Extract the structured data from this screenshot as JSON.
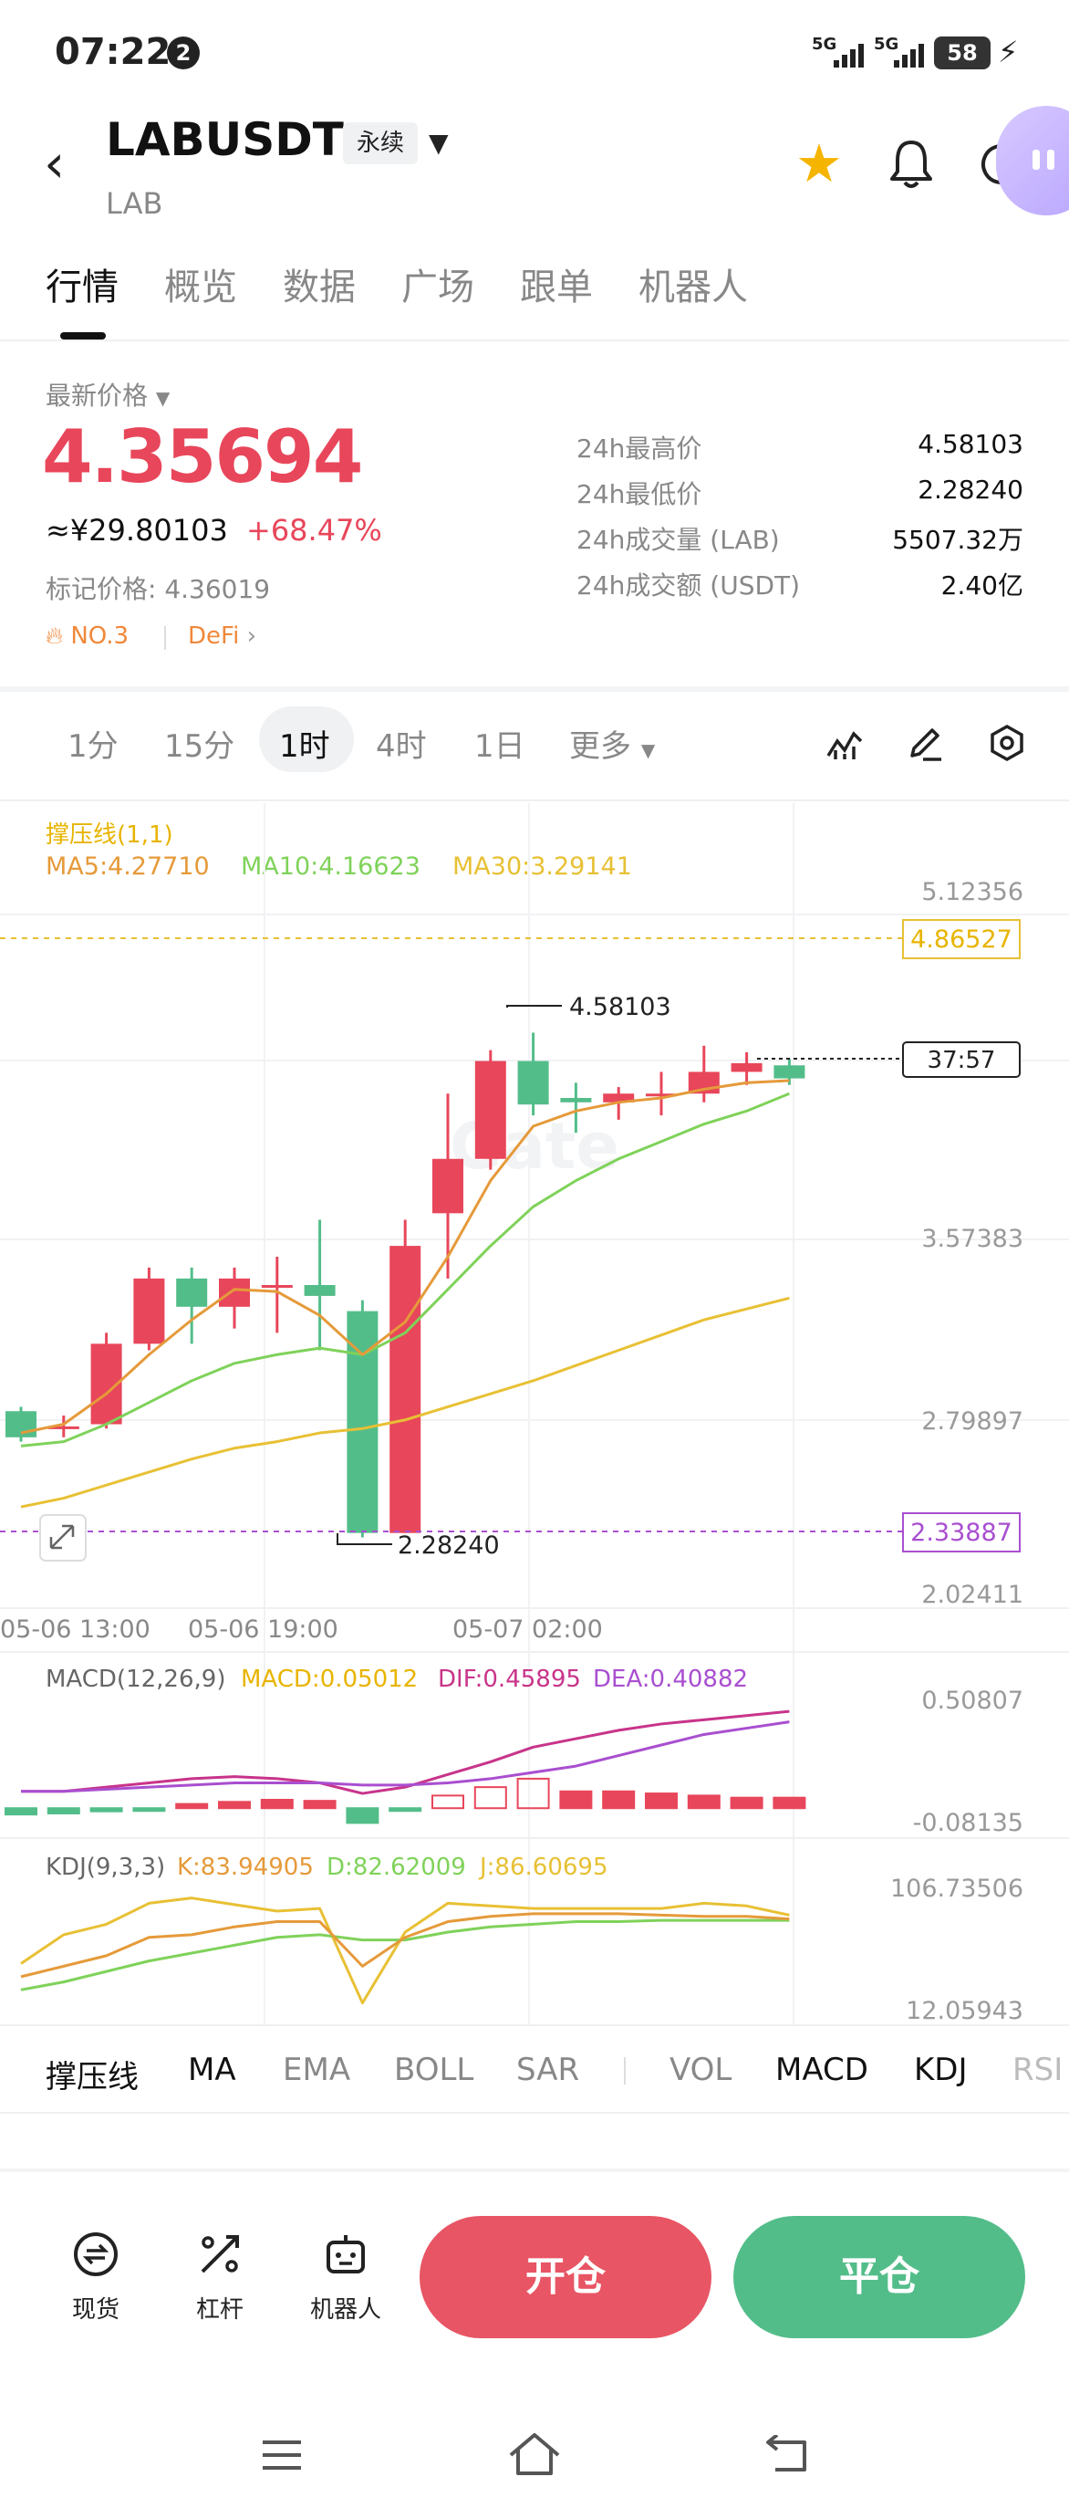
{
  "status_bar": {
    "time": "07:22",
    "notif_count": "2",
    "net1": "5G",
    "net2": "5G",
    "battery": "58"
  },
  "header": {
    "symbol": "LABUSDT",
    "contract_type": "永续",
    "base": "LAB"
  },
  "tabs": [
    {
      "label": "行情"
    },
    {
      "label": "概览"
    },
    {
      "label": "数据"
    },
    {
      "label": "广场"
    },
    {
      "label": "跟单"
    },
    {
      "label": "机器人"
    }
  ],
  "ticker": {
    "latest_label": "最新价格",
    "price": "4.35694",
    "cny": "≈¥29.80103",
    "change": "+68.47%",
    "mark_price": "标记价格: 4.36019",
    "rank": "NO.3",
    "tag": "DeFi",
    "stats": [
      {
        "label": "24h最高价",
        "value": "4.58103"
      },
      {
        "label": "24h最低价",
        "value": "2.28240"
      },
      {
        "label": "24h成交量 (LAB)",
        "value": "5507.32万"
      },
      {
        "label": "24h成交额 (USDT)",
        "value": "2.40亿"
      }
    ]
  },
  "intervals": [
    {
      "label": "1分"
    },
    {
      "label": "15分"
    },
    {
      "label": "1时"
    },
    {
      "label": "4时"
    },
    {
      "label": "1日"
    },
    {
      "label": "更多"
    }
  ],
  "chart_legend": {
    "sr": "撑压线(1,1)",
    "ma5": "MA5:4.27710",
    "ma10": "MA10:4.16623",
    "ma30": "MA30:3.29141"
  },
  "chart_labels": {
    "y_ticks": [
      "5.12356",
      "3.57383",
      "2.79897",
      "2.02411"
    ],
    "resistance": "4.86527",
    "support": "2.33887",
    "countdown": "37:57",
    "high": "4.58103",
    "low": "2.28240",
    "x_ticks": [
      "05-06 13:00",
      "05-06 19:00",
      "05-07 02:00"
    ],
    "macd_legend": {
      "name": "MACD(12,26,9)",
      "macd": "MACD:0.05012",
      "dif": "DIF:0.45895",
      "dea": "DEA:0.40882"
    },
    "macd_ticks": [
      "0.50807",
      "-0.08135"
    ],
    "kdj_legend": {
      "name": "KDJ(9,3,3)",
      "k": "K:83.94905",
      "d": "D:82.62009",
      "j": "J:86.60695"
    },
    "kdj_ticks": [
      "106.73506",
      "12.05943"
    ]
  },
  "chart_data": {
    "type": "candlestick",
    "ylim": [
      2.02411,
      5.12356
    ],
    "candles": [
      {
        "o": 2.84,
        "h": 2.86,
        "c": 2.72,
        "l": 2.7
      },
      {
        "o": 2.76,
        "h": 2.82,
        "c": 2.77,
        "l": 2.72
      },
      {
        "o": 2.78,
        "h": 3.2,
        "c": 3.15,
        "l": 2.76
      },
      {
        "o": 3.15,
        "h": 3.5,
        "c": 3.45,
        "l": 3.12
      },
      {
        "o": 3.45,
        "h": 3.5,
        "c": 3.32,
        "l": 3.15
      },
      {
        "o": 3.32,
        "h": 3.5,
        "c": 3.45,
        "l": 3.22
      },
      {
        "o": 3.42,
        "h": 3.55,
        "c": 3.42,
        "l": 3.2
      },
      {
        "o": 3.42,
        "h": 3.72,
        "c": 3.37,
        "l": 3.12
      },
      {
        "o": 3.3,
        "h": 3.35,
        "c": 2.28,
        "l": 2.26
      },
      {
        "o": 2.28,
        "h": 3.72,
        "c": 3.6,
        "l": 2.28
      },
      {
        "o": 3.75,
        "h": 4.3,
        "c": 4.0,
        "l": 3.45
      },
      {
        "o": 4.0,
        "h": 4.5,
        "c": 4.45,
        "l": 3.95
      },
      {
        "o": 4.45,
        "h": 4.58,
        "c": 4.25,
        "l": 4.2
      },
      {
        "o": 4.28,
        "h": 4.35,
        "c": 4.26,
        "l": 4.12
      },
      {
        "o": 4.26,
        "h": 4.33,
        "c": 4.3,
        "l": 4.18
      },
      {
        "o": 4.3,
        "h": 4.4,
        "c": 4.3,
        "l": 4.2
      },
      {
        "o": 4.3,
        "h": 4.52,
        "c": 4.4,
        "l": 4.26
      },
      {
        "o": 4.4,
        "h": 4.49,
        "c": 4.44,
        "l": 4.34
      },
      {
        "o": 4.43,
        "h": 4.46,
        "c": 4.37,
        "l": 4.34
      }
    ],
    "ma5": [
      2.74,
      2.78,
      2.92,
      3.1,
      3.26,
      3.4,
      3.39,
      3.28,
      3.1,
      3.25,
      3.55,
      3.9,
      4.15,
      4.22,
      4.26,
      4.28,
      4.32,
      4.35,
      4.36
    ],
    "ma10": [
      2.68,
      2.7,
      2.78,
      2.88,
      2.98,
      3.06,
      3.1,
      3.13,
      3.1,
      3.2,
      3.4,
      3.6,
      3.78,
      3.9,
      4.0,
      4.08,
      4.16,
      4.22,
      4.3
    ],
    "ma30": [
      2.4,
      2.44,
      2.5,
      2.56,
      2.62,
      2.67,
      2.7,
      2.74,
      2.76,
      2.8,
      2.86,
      2.92,
      2.98,
      3.05,
      3.12,
      3.19,
      3.26,
      3.31,
      3.36
    ],
    "macd_hist": [
      -0.03,
      -0.025,
      -0.015,
      -0.005,
      0.02,
      0.03,
      0.04,
      0.035,
      -0.07,
      -0.01,
      0.06,
      0.1,
      0.14,
      0.08,
      0.08,
      0.07,
      0.06,
      0.05,
      0.05
    ],
    "dif": [
      0.08,
      0.08,
      0.1,
      0.12,
      0.14,
      0.15,
      0.14,
      0.12,
      0.07,
      0.1,
      0.16,
      0.22,
      0.29,
      0.33,
      0.37,
      0.4,
      0.42,
      0.44,
      0.46
    ],
    "dea": [
      0.08,
      0.08,
      0.09,
      0.1,
      0.11,
      0.12,
      0.12,
      0.12,
      0.11,
      0.11,
      0.12,
      0.14,
      0.17,
      0.2,
      0.25,
      0.3,
      0.35,
      0.38,
      0.41
    ],
    "kdj_k": [
      40,
      48,
      56,
      70,
      72,
      78,
      82,
      82,
      48,
      70,
      82,
      86,
      88,
      88,
      88,
      87,
      86,
      86,
      84
    ],
    "kdj_d": [
      30,
      36,
      44,
      52,
      58,
      64,
      70,
      72,
      68,
      68,
      74,
      78,
      80,
      82,
      82,
      83,
      83,
      83,
      83
    ],
    "kdj_j": [
      50,
      72,
      80,
      96,
      100,
      95,
      90,
      92,
      20,
      74,
      96,
      94,
      92,
      92,
      92,
      92,
      96,
      94,
      87
    ]
  },
  "indicator_tabs": [
    {
      "label": "撑压线"
    },
    {
      "label": "MA"
    },
    {
      "label": "EMA"
    },
    {
      "label": "BOLL"
    },
    {
      "label": "SAR"
    },
    {
      "label": "VOL"
    },
    {
      "label": "MACD"
    },
    {
      "label": "KDJ"
    },
    {
      "label": "RSI"
    }
  ],
  "bottom_nav": {
    "spot": "现货",
    "lever": "杠杆",
    "robot": "机器人",
    "open": "开仓",
    "close": "平仓"
  },
  "colors": {
    "up": "#e8465a",
    "down": "#53bd8a",
    "ma5": "#e59a3a",
    "ma10": "#7fd25a",
    "ma30": "#e8c034",
    "dif": "#c8348a",
    "dea": "#a94fd0"
  }
}
